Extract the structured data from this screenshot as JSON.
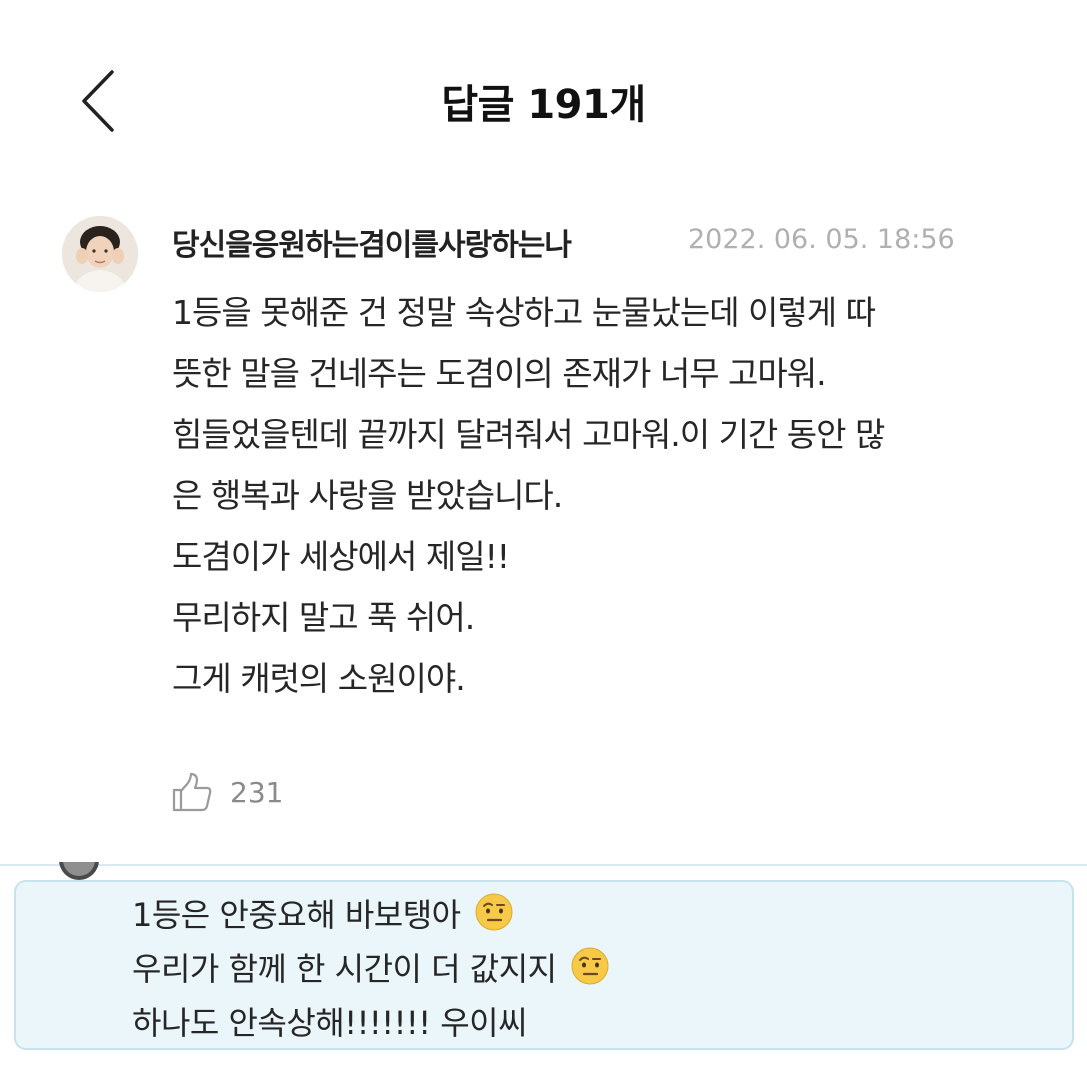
{
  "header": {
    "title": "답글 191개"
  },
  "comment": {
    "author": "당신을응원하는겸이를사랑하는나",
    "date": "2022. 06. 05. 18:56",
    "lines": [
      "1등을 못해준 건 정말 속상하고 눈물났는데 이렇게 따",
      "뜻한 말을 건네주는 도겸이의 존재가 너무 고마워.",
      "힘들었을텐데 끝까지 달려줘서 고마워.이 기간 동안 많",
      "은 행복과 사랑을 받았습니다.",
      "도겸이가 세상에서 제일!!",
      "무리하지 말고 푹 쉬어.",
      "그게 캐럿의 소원이야."
    ],
    "like_count": "231"
  },
  "reply": {
    "lines": [
      "1등은 안중요해 바보탱아",
      "우리가 함께 한 시간이 더 값지지",
      "하나도 안속상해!!!!!!! 우이씨"
    ],
    "emoji": "raised-eyebrow-emoji"
  },
  "icons": {
    "back": "chevron-left-icon",
    "like": "thumbs-up-icon"
  },
  "colors": {
    "highlight_bg": "#ebf6fb",
    "highlight_border": "#c6e3ee",
    "date_gray": "#b0b0b0"
  }
}
